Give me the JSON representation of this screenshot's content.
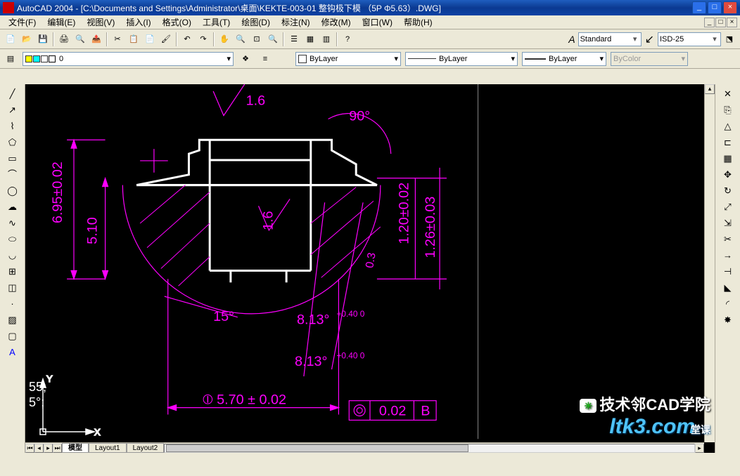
{
  "title": "AutoCAD 2004 - [C:\\Documents and Settings\\Administrator\\桌面\\KEKTE-003-01 整钩极下模 （5P Φ5.63）.DWG]",
  "menus": [
    "文件(F)",
    "编辑(E)",
    "视图(V)",
    "插入(I)",
    "格式(O)",
    "工具(T)",
    "绘图(D)",
    "标注(N)",
    "修改(M)",
    "窗口(W)",
    "帮助(H)"
  ],
  "style": {
    "text": "Standard",
    "dim": "ISD-25"
  },
  "layer": {
    "current": "0"
  },
  "props": {
    "color": "ByLayer",
    "linetype": "ByLayer",
    "lineweight": "ByLayer",
    "plotstyle": "ByColor"
  },
  "dims": {
    "d1": "6.95±0.02",
    "d2": "5.10",
    "d3": "1.20±0.02",
    "d4": "1.26±0.03",
    "d5": "1.6",
    "d6": "1.6",
    "ang90": "90°",
    "ang15": "15°",
    "ang8a": "8.13°",
    "tol8a": "+0.40\n0",
    "ang8b": "8.13°",
    "tol8b": "+0.40\n0",
    "d7": "5.70 ± 0.02",
    "gtol": "0.02",
    "datum": "B",
    "d8": "0.3"
  },
  "cmd": {
    "line1": "55;",
    "line2": "5°;"
  },
  "ucs": {
    "x": "X",
    "y": "Y"
  },
  "tabs": {
    "model": "模型",
    "layout1": "Layout1",
    "layout2": "Layout2"
  },
  "watermark": {
    "line1": "技术邻CAD学院",
    "line2": "ltk3.com",
    "sub": "堂课"
  },
  "winbtns": {
    "min": "_",
    "max": "□",
    "close": "×"
  }
}
